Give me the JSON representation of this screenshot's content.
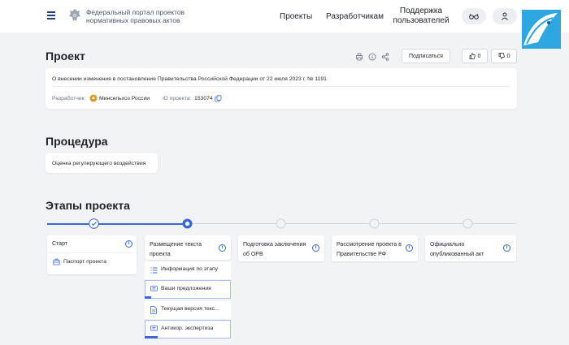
{
  "header": {
    "portal_title": "Федеральный портал проектов нормативных правовых актов",
    "nav": [
      "Проекты",
      "Разработчикам"
    ],
    "support": "Поддержка пользователей"
  },
  "project": {
    "heading": "Проект",
    "subscribe": "Подписаться",
    "likes": "0",
    "dislikes": "0",
    "description": "О внесении изменения в постановление Правительства Российской Федерации от 22 июля 2023 г. № 1191",
    "developer_label": "Разработчик:",
    "developer": "Минсельхоз России",
    "id_label": "ID проекта:",
    "id": "153074"
  },
  "procedure": {
    "heading": "Процедура",
    "value": "Оценка регулирующего воздействия"
  },
  "stages": {
    "heading": "Этапы проекта",
    "items": [
      "Старт",
      "Размещение текста проекта",
      "Подготовка заключения об ОРВ",
      "Рассмотрение проекта в Правительстве РФ",
      "Официально опубликованный акт"
    ],
    "start_sub": "Паспорт проекта",
    "placement_sub": [
      "Информация по этапу",
      "Ваши предложения",
      "Текущая версия текс...",
      "Антикор. экспертиза"
    ]
  },
  "colors": {
    "accent": "#3a68d8",
    "brand": "#1f3e7a",
    "page_bg": "#f2f3f5"
  }
}
